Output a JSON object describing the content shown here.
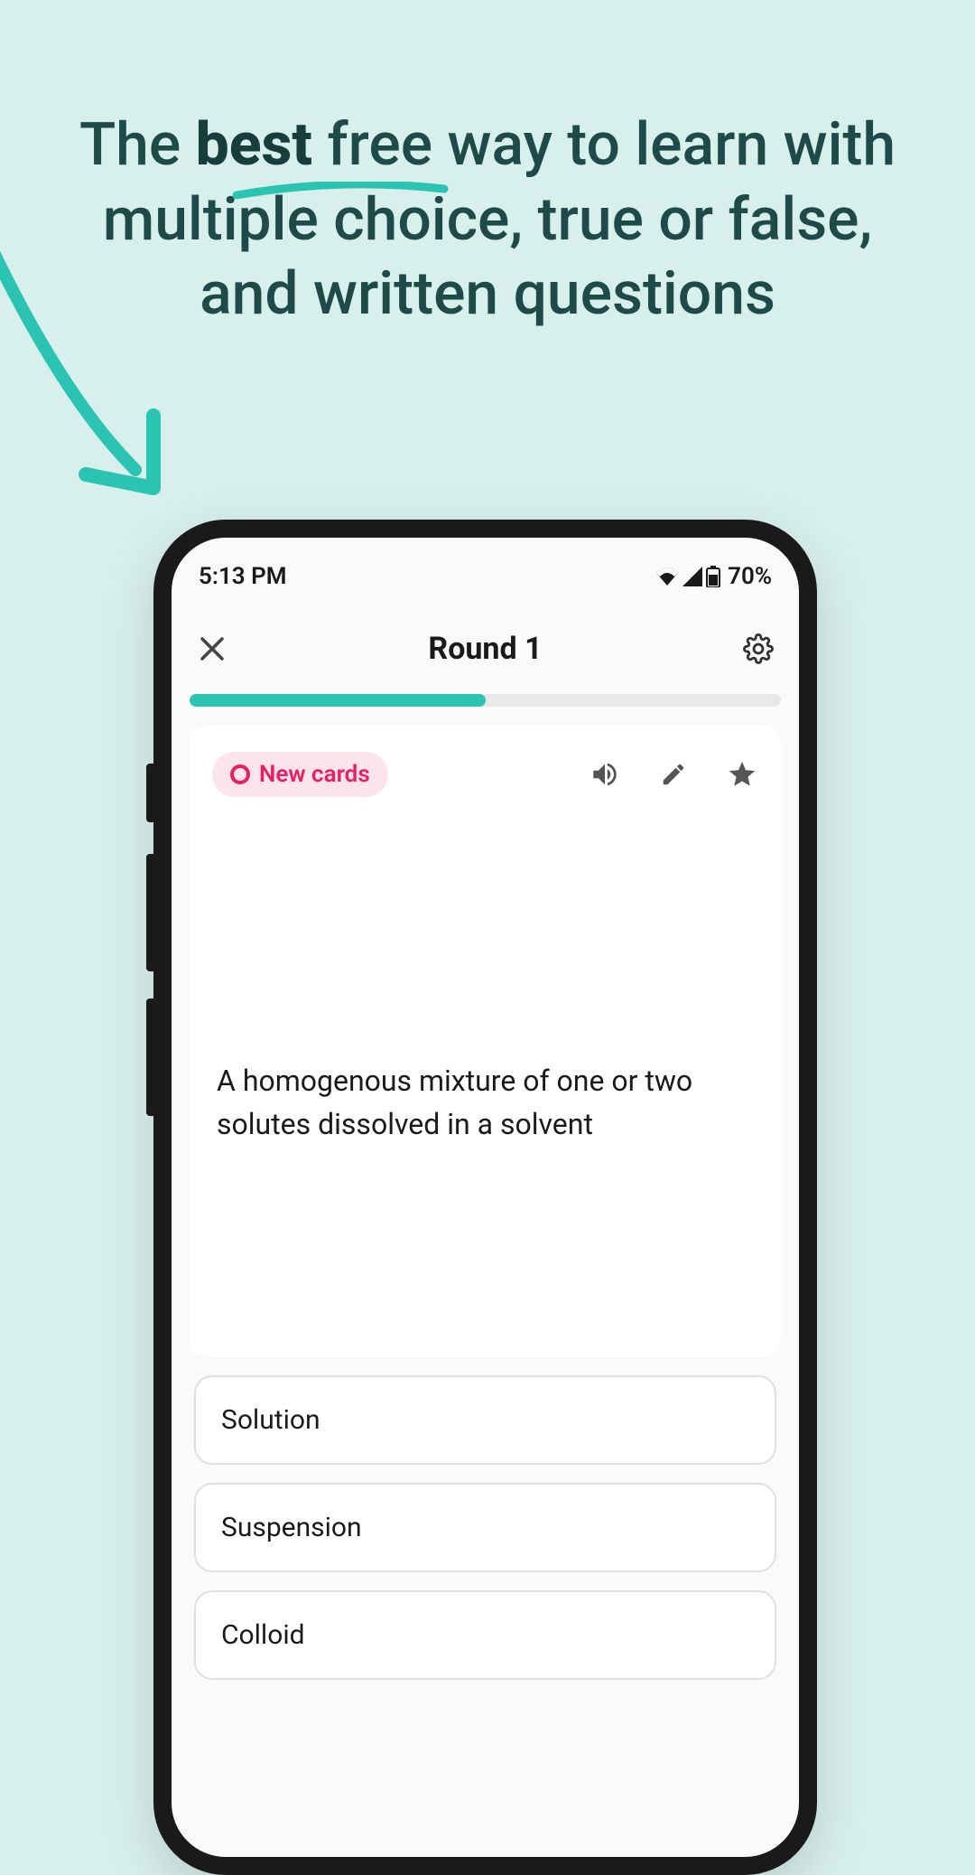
{
  "headline": {
    "part1": "The ",
    "bold": "best",
    "part2": " free way to learn with multiple choice, true or false, and written questions"
  },
  "statusBar": {
    "time": "5:13 PM",
    "battery": "70%"
  },
  "header": {
    "title": "Round 1"
  },
  "progress": {
    "percent": 50
  },
  "card": {
    "badge": "New cards",
    "question": "A homogenous mixture of one or two solutes dissolved in a solvent"
  },
  "answers": [
    "Solution",
    "Suspension",
    "Colloid"
  ]
}
